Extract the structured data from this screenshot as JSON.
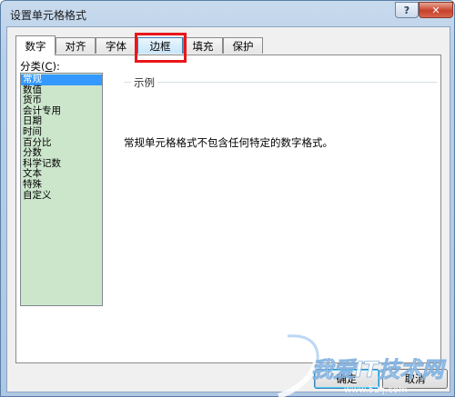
{
  "window": {
    "title": "设置单元格格式",
    "help_glyph": "?",
    "close_glyph": "✕"
  },
  "tabs": [
    {
      "label": "数字",
      "active": true
    },
    {
      "label": "对齐"
    },
    {
      "label": "字体"
    },
    {
      "label": "边框",
      "highlighted": true
    },
    {
      "label": "填充"
    },
    {
      "label": "保护"
    }
  ],
  "category": {
    "label_prefix": "分类(",
    "label_key": "C",
    "label_suffix": "):",
    "items": [
      "常规",
      "数值",
      "货币",
      "会计专用",
      "日期",
      "时间",
      "百分比",
      "分数",
      "科学记数",
      "文本",
      "特殊",
      "自定义"
    ],
    "selected_index": 0
  },
  "sample": {
    "legend": "示例"
  },
  "description": "常规单元格格式不包含任何特定的数字格式。",
  "buttons": {
    "ok": "确定",
    "cancel": "取消"
  },
  "watermark": {
    "text": "我爱IT技术网",
    "url": "www.52ij.com"
  },
  "colors": {
    "highlight_box": "#e8161b",
    "list_selection": "#3399ff",
    "list_background": "#cce6cc"
  }
}
